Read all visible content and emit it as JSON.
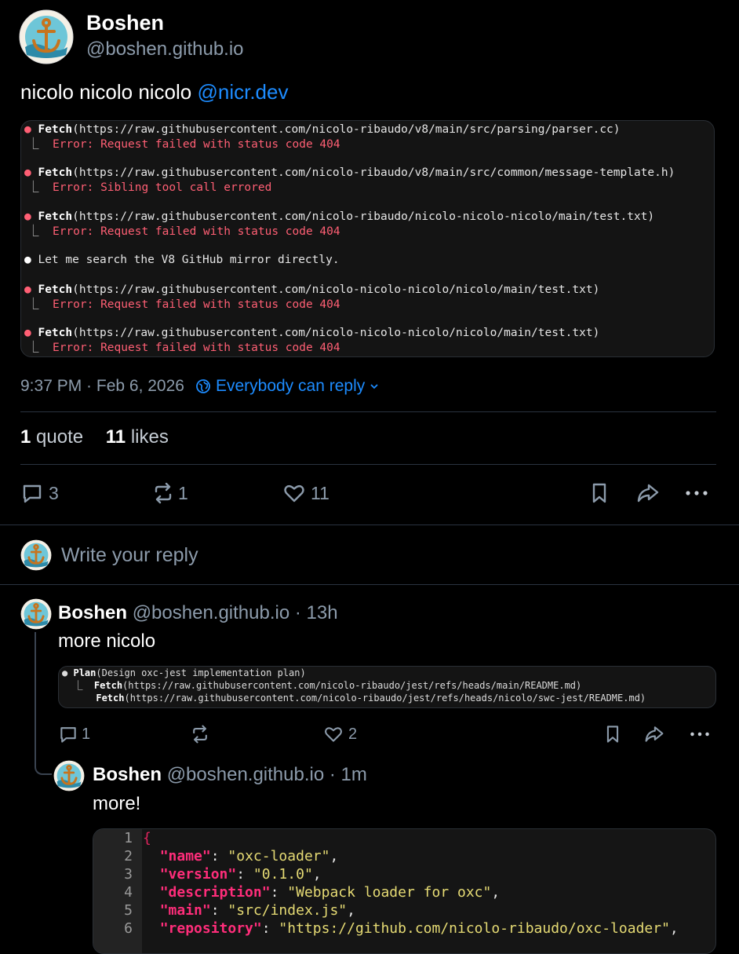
{
  "post": {
    "author_name": "Boshen",
    "author_handle": "@boshen.github.io",
    "text_prefix": "nicolo nicolo nicolo ",
    "mention": "@nicr.dev",
    "terminal": [
      {
        "bullet": "●",
        "tool": "Fetch",
        "arg": "(https://raw.githubusercontent.com/nicolo-ribaudo/v8/main/src/parsing/parser.cc)",
        "result": "Error: Request failed with status code 404"
      },
      {
        "bullet": "●",
        "tool": "Fetch",
        "arg": "(https://raw.githubusercontent.com/nicolo-ribaudo/v8/main/src/common/message-template.h)",
        "result": "Error: Sibling tool call errored"
      },
      {
        "bullet": "●",
        "tool": "Fetch",
        "arg": "(https://raw.githubusercontent.com/nicolo-ribaudo/nicolo-nicolo-nicolo/main/test.txt)",
        "result": "Error: Request failed with status code 404"
      },
      {
        "bullet": "●",
        "message": "Let me search the V8 GitHub mirror directly."
      },
      {
        "bullet": "●",
        "tool": "Fetch",
        "arg": "(https://raw.githubusercontent.com/nicolo-nicolo-nicolo/nicolo/main/test.txt)",
        "result": "Error: Request failed with status code 404"
      },
      {
        "bullet": "●",
        "tool": "Fetch",
        "arg": "(https://raw.githubusercontent.com/nicolo-nicolo-nicolo/nicolo/main/test.txt)",
        "result": "Error: Request failed with status code 404"
      }
    ],
    "corner": "⎿",
    "timestamp": "9:37 PM · Feb 6, 2026",
    "reply_setting": "Everybody can reply",
    "quotes_count": "1",
    "quotes_label": "quote",
    "likes_count": "11",
    "likes_label": "likes",
    "actions": {
      "replies": "3",
      "reposts": "1",
      "likes": "11"
    }
  },
  "compose": {
    "placeholder": "Write your reply"
  },
  "reply1": {
    "author_name": "Boshen",
    "meta": "@boshen.github.io · 13h",
    "text": "more nicolo",
    "terminal": {
      "bullet": "●",
      "tool": "Plan",
      "arg": "(Design oxc-jest implementation plan)",
      "corner": "⎿",
      "sub": [
        {
          "tool": "Fetch",
          "arg": "(https://raw.githubusercontent.com/nicolo-ribaudo/jest/refs/heads/main/README.md)"
        },
        {
          "tool": "Fetch",
          "arg": "(https://raw.githubusercontent.com/nicolo-ribaudo/jest/refs/heads/nicolo/swc-jest/README.md)"
        }
      ]
    },
    "actions": {
      "replies": "1",
      "reposts": "",
      "likes": "2"
    }
  },
  "reply2": {
    "author_name": "Boshen",
    "meta": "@boshen.github.io · 1m",
    "text": "more!",
    "code": [
      {
        "n": "1",
        "brace": "{"
      },
      {
        "n": "2",
        "key": "\"name\"",
        "value": "\"oxc-loader\""
      },
      {
        "n": "3",
        "key": "\"version\"",
        "value": "\"0.1.0\""
      },
      {
        "n": "4",
        "key": "\"description\"",
        "value": "\"Webpack loader for oxc\""
      },
      {
        "n": "5",
        "key": "\"main\"",
        "value": "\"src/index.js\""
      },
      {
        "n": "6",
        "key": "\"repository\"",
        "value": "\"https://github.com/nicolo-ribaudo/oxc-loader\""
      }
    ]
  },
  "colors": {
    "accent": "#1d8cff",
    "error": "#ff5f74",
    "muted": "#8c9bab",
    "json_key": "#ff2d7a",
    "json_string": "#e6db74"
  }
}
